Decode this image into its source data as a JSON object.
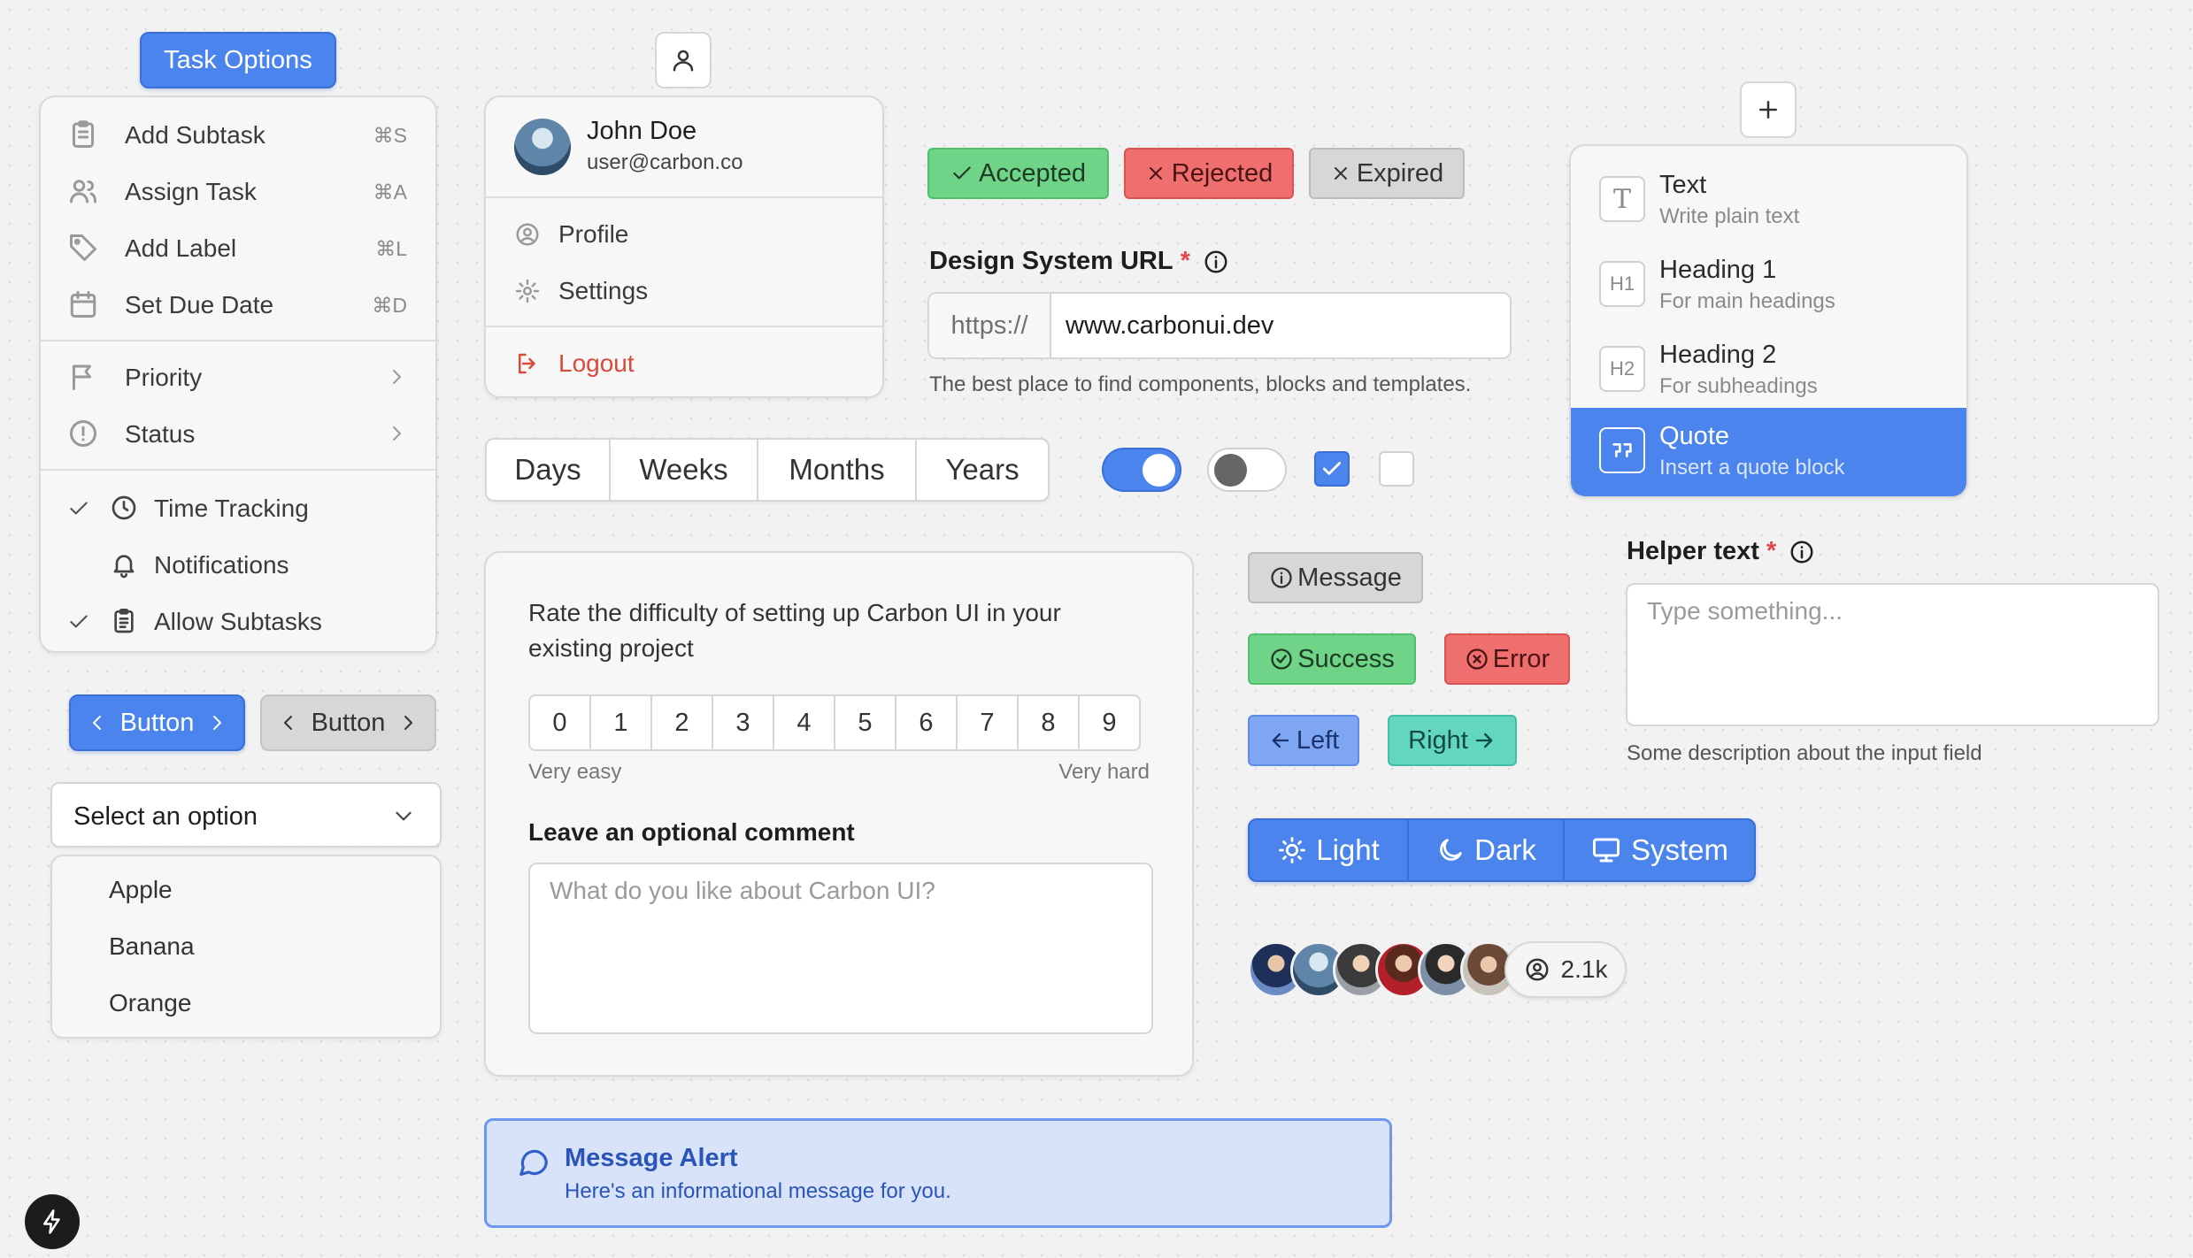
{
  "task_options": {
    "button_label": "Task Options",
    "items": [
      {
        "label": "Add Subtask",
        "shortcut": "⌘S",
        "icon": "clipboard-icon"
      },
      {
        "label": "Assign Task",
        "shortcut": "⌘A",
        "icon": "users-icon"
      },
      {
        "label": "Add Label",
        "shortcut": "⌘L",
        "icon": "tag-icon"
      },
      {
        "label": "Set Due Date",
        "shortcut": "⌘D",
        "icon": "calendar-icon"
      }
    ],
    "submenus": [
      {
        "label": "Priority",
        "icon": "flag-icon"
      },
      {
        "label": "Status",
        "icon": "alert-circle-icon"
      }
    ],
    "checks": [
      {
        "label": "Time Tracking",
        "checked": true,
        "icon": "clock-icon"
      },
      {
        "label": "Notifications",
        "checked": false,
        "icon": "bell-icon"
      },
      {
        "label": "Allow Subtasks",
        "checked": true,
        "icon": "clipboard-list-icon"
      }
    ]
  },
  "buttons": {
    "primary": "Button",
    "secondary": "Button"
  },
  "select": {
    "placeholder": "Select an option",
    "options": [
      "Apple",
      "Banana",
      "Orange"
    ]
  },
  "user_menu": {
    "name": "John Doe",
    "email": "user@carbon.co",
    "items": [
      "Profile",
      "Settings"
    ],
    "logout": "Logout"
  },
  "badges": {
    "accepted": "Accepted",
    "rejected": "Rejected",
    "expired": "Expired"
  },
  "url_field": {
    "label": "Design System URL",
    "required_mark": "*",
    "prefix": "https://",
    "value": "www.carbonui.dev",
    "help": "The best place to find components, blocks and templates."
  },
  "segments": [
    "Days",
    "Weeks",
    "Months",
    "Years"
  ],
  "toggles": {
    "toggle1_on": true,
    "toggle2_on": false,
    "checkbox1_checked": true,
    "checkbox2_checked": false
  },
  "feedback": {
    "question": "Rate the difficulty of setting up Carbon UI in your existing project",
    "scale": [
      "0",
      "1",
      "2",
      "3",
      "4",
      "5",
      "6",
      "7",
      "8",
      "9"
    ],
    "min_label": "Very easy",
    "max_label": "Very hard",
    "comment_label": "Leave an optional comment",
    "comment_placeholder": "What do you like about Carbon UI?"
  },
  "alert": {
    "title": "Message Alert",
    "body": "Here's an informational message for you."
  },
  "tags": {
    "message": "Message",
    "success": "Success",
    "error": "Error",
    "left": "Left",
    "right": "Right"
  },
  "theme": [
    "Light",
    "Dark",
    "System"
  ],
  "avatars": {
    "count": "2.1k"
  },
  "blocks": {
    "items": [
      {
        "title": "Text",
        "subtitle": "Write plain text",
        "icon": "T"
      },
      {
        "title": "Heading 1",
        "subtitle": "For main headings",
        "icon": "H1"
      },
      {
        "title": "Heading 2",
        "subtitle": "For subheadings",
        "icon": "H2"
      },
      {
        "title": "Quote",
        "subtitle": "Insert a quote block",
        "icon": "quote-icon"
      }
    ],
    "selected_index": 3
  },
  "helper": {
    "label": "Helper text",
    "required_mark": "*",
    "placeholder": "Type something...",
    "description": "Some description about the input field"
  },
  "colors": {
    "primary": "#4a84ec",
    "success": "#6fd487",
    "danger": "#ef6e6e",
    "teal": "#63d6c0",
    "logout": "#d94a3a"
  }
}
